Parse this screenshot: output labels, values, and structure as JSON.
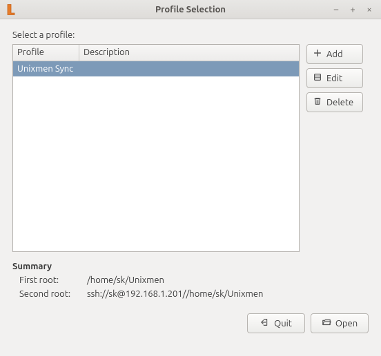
{
  "window": {
    "title": "Profile Selection"
  },
  "labels": {
    "select_profile": "Select a profile:"
  },
  "table": {
    "headers": {
      "profile": "Profile",
      "description": "Description"
    },
    "rows": [
      {
        "profile": "Unixmen Sync",
        "description": "",
        "selected": true
      }
    ]
  },
  "buttons": {
    "add": "Add",
    "edit": "Edit",
    "delete": "Delete",
    "quit": "Quit",
    "open": "Open"
  },
  "summary": {
    "title": "Summary",
    "first_root_label": "First root:",
    "first_root_value": "/home/sk/Unixmen",
    "second_root_label": "Second root:",
    "second_root_value": "ssh://sk@192.168.1.201//home/sk/Unixmen"
  }
}
